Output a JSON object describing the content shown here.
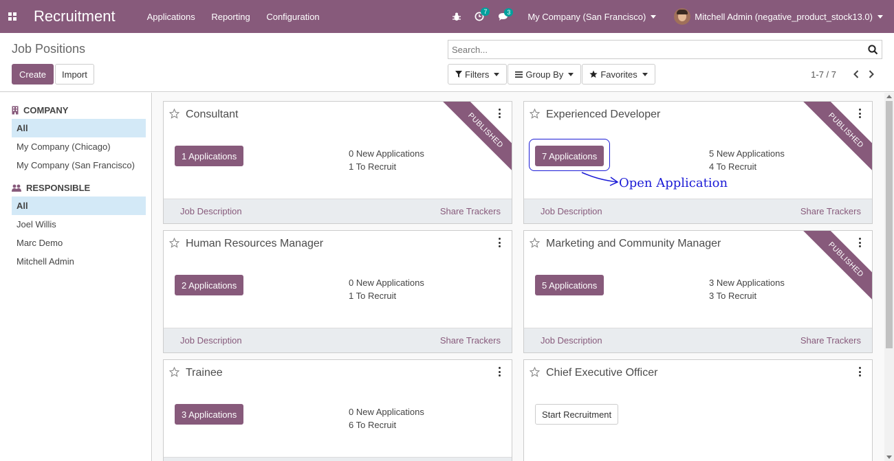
{
  "navbar": {
    "app_name": "Recruitment",
    "menu": [
      "Applications",
      "Reporting",
      "Configuration"
    ],
    "activities_count": "7",
    "messages_count": "3",
    "company": "My Company (San Francisco)",
    "user": "Mitchell Admin (negative_product_stock13.0)"
  },
  "control": {
    "title": "Job Positions",
    "create_label": "Create",
    "import_label": "Import",
    "search_placeholder": "Search...",
    "filters_label": "Filters",
    "groupby_label": "Group By",
    "favorites_label": "Favorites",
    "pager": "1-7 / 7"
  },
  "sidebar": {
    "company_heading": "COMPANY",
    "company_items": [
      "All",
      "My Company (Chicago)",
      "My Company (San Francisco)"
    ],
    "responsible_heading": "RESPONSIBLE",
    "responsible_items": [
      "All",
      "Joel Willis",
      "Marc Demo",
      "Mitchell Admin"
    ]
  },
  "cards": [
    {
      "title": "Consultant",
      "applications": "1 Applications",
      "new_apps": "0 New Applications",
      "to_recruit": "1 To Recruit",
      "published": true
    },
    {
      "title": "Experienced Developer",
      "applications": "7 Applications",
      "new_apps": "5 New Applications",
      "to_recruit": "4 To Recruit",
      "published": true
    },
    {
      "title": "Human Resources Manager",
      "applications": "2 Applications",
      "new_apps": "0 New Applications",
      "to_recruit": "1 To Recruit",
      "published": false
    },
    {
      "title": "Marketing and Community Manager",
      "applications": "5 Applications",
      "new_apps": "3 New Applications",
      "to_recruit": "3 To Recruit",
      "published": true
    },
    {
      "title": "Trainee",
      "applications": "3 Applications",
      "new_apps": "0 New Applications",
      "to_recruit": "6 To Recruit",
      "published": false
    },
    {
      "title": "Chief Executive Officer",
      "start_label": "Start Recruitment",
      "published": false
    }
  ],
  "card_common": {
    "job_description": "Job Description",
    "share_trackers": "Share Trackers",
    "ribbon": "PUBLISHED"
  },
  "annotation": {
    "text": "Open Application"
  },
  "colors": {
    "brand": "#875a7b",
    "annotation": "#1a1ad6",
    "active_filter": "#d3e9f7"
  }
}
